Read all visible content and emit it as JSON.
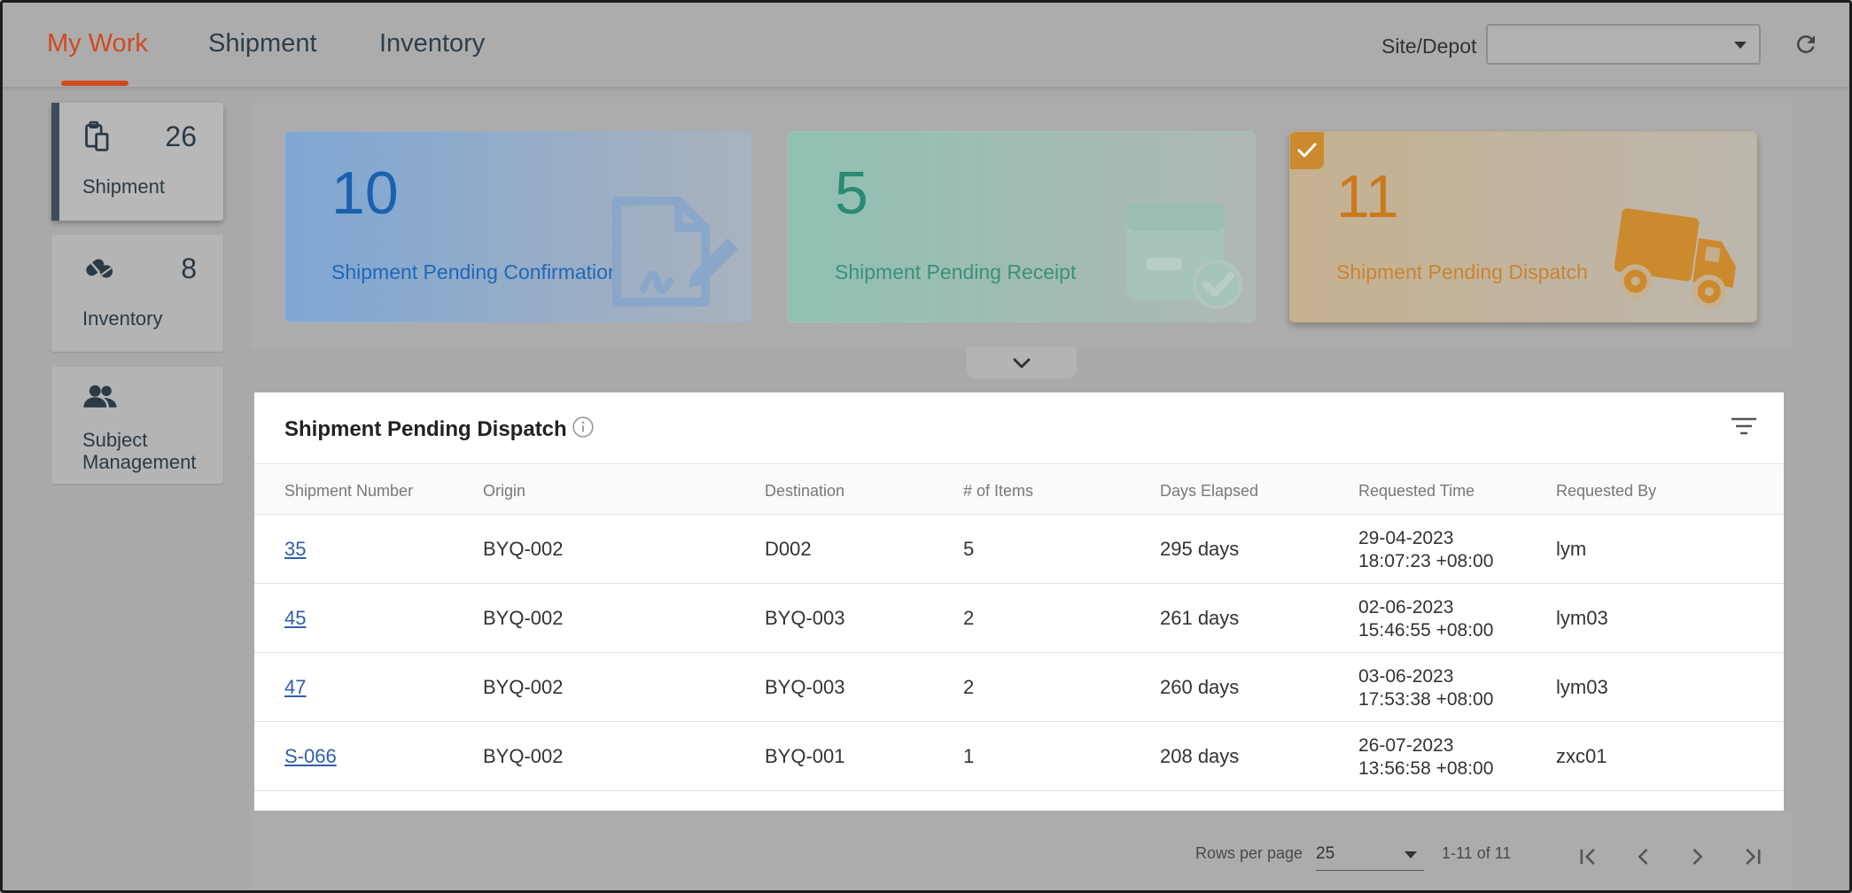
{
  "nav": {
    "tabs": [
      {
        "label": "My Work",
        "active": true
      },
      {
        "label": "Shipment",
        "active": false
      },
      {
        "label": "Inventory",
        "active": false
      }
    ],
    "site_label": "Site/Depot",
    "site_value": "",
    "icons": {
      "refresh": "refresh-icon",
      "dropdown": "chevron-down-icon"
    }
  },
  "sidebar": {
    "items": [
      {
        "label": "Shipment",
        "count": "26",
        "icon": "clipboard-icon",
        "active": true
      },
      {
        "label": "Inventory",
        "count": "8",
        "icon": "pills-icon",
        "active": false
      },
      {
        "label": "Subject Management",
        "count": "",
        "icon": "people-icon",
        "active": false
      }
    ]
  },
  "summary": {
    "cards": [
      {
        "value": "10",
        "label": "Shipment Pending Confirmation",
        "color": "#1a61b0",
        "icon": "document-sign-icon"
      },
      {
        "value": "5",
        "label": "Shipment Pending Receipt",
        "color": "#2a8a72",
        "icon": "box-check-icon"
      },
      {
        "value": "11",
        "label": "Shipment Pending Dispatch",
        "color": "#c97a1c",
        "icon": "truck-icon",
        "selected": true
      }
    ]
  },
  "table": {
    "title": "Shipment Pending Dispatch",
    "columns": [
      "Shipment Number",
      "Origin",
      "Destination",
      "# of Items",
      "Days Elapsed",
      "Requested Time",
      "Requested By"
    ],
    "rows": [
      {
        "number": "35",
        "origin": "BYQ-002",
        "destination": "D002",
        "items": "5",
        "days": "295 days",
        "time_date": "29-04-2023",
        "time_clock": "18:07:23 +08:00",
        "by": "lym"
      },
      {
        "number": "45",
        "origin": "BYQ-002",
        "destination": "BYQ-003",
        "items": "2",
        "days": "261 days",
        "time_date": "02-06-2023",
        "time_clock": "15:46:55 +08:00",
        "by": "lym03"
      },
      {
        "number": "47",
        "origin": "BYQ-002",
        "destination": "BYQ-003",
        "items": "2",
        "days": "260 days",
        "time_date": "03-06-2023",
        "time_clock": "17:53:38 +08:00",
        "by": "lym03"
      },
      {
        "number": "S-066",
        "origin": "BYQ-002",
        "destination": "BYQ-001",
        "items": "1",
        "days": "208 days",
        "time_date": "26-07-2023",
        "time_clock": "13:56:58 +08:00",
        "by": "zxc01"
      }
    ]
  },
  "pagination": {
    "rows_per_page_label": "Rows per page",
    "rows_per_page_value": "25",
    "range": "1-11 of 11"
  },
  "colors": {
    "accent": "#d04a20",
    "link": "#2f5fa8"
  }
}
